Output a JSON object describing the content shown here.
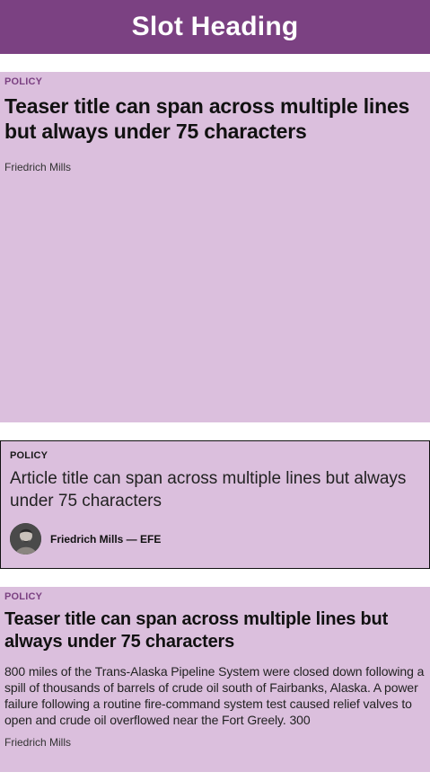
{
  "slot": {
    "heading": "Slot Heading"
  },
  "teaser_1": {
    "kicker": "POLICY",
    "title": "Teaser title can span across multiple lines but always under 75 characters",
    "author": "Friedrich Mills"
  },
  "article": {
    "kicker": "POLICY",
    "title": "Article title can span across multiple lines but always under 75 characters",
    "byline": "Friedrich Mills — EFE",
    "avatar_icon": "author-photo"
  },
  "teaser_2": {
    "kicker": "POLICY",
    "title": "Teaser title can span across multiple lines but always under 75 characters",
    "summary": "800 miles of the Trans-Alaska Pipeline System were closed down following a spill of thousands of barrels of crude oil south of Fairbanks, Alaska. A power failure following a routine fire-command system test caused relief valves to open and crude oil overflowed near the Fort Greely. 300",
    "author": "Friedrich Mills"
  },
  "colors": {
    "header_bg": "#7b4182",
    "card_bg": "#dbbfdd",
    "kicker_purple": "#7b4182"
  }
}
